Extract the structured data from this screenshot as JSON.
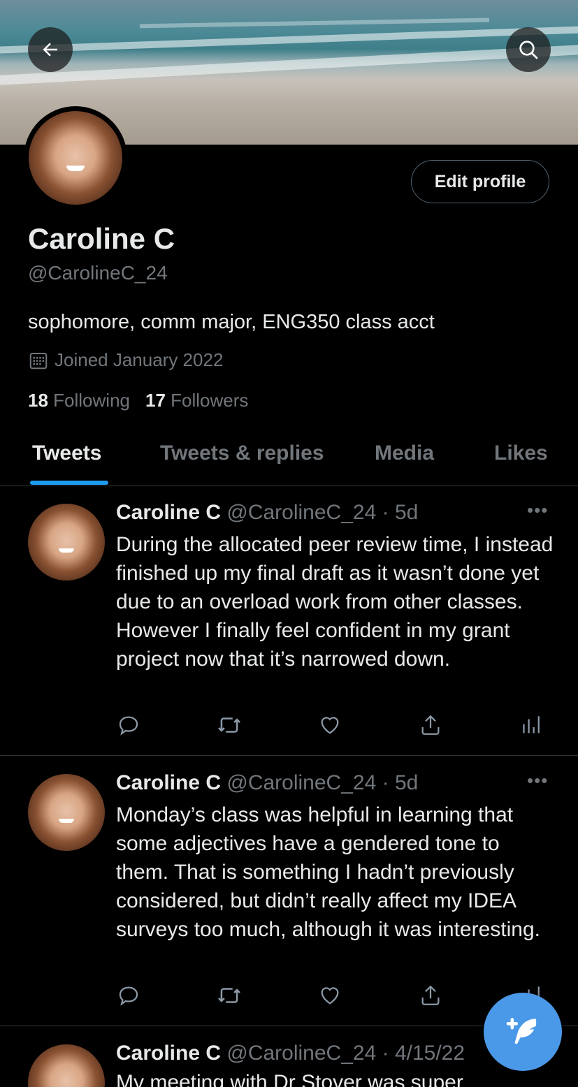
{
  "profile": {
    "name": "Caroline C",
    "handle": "@CarolineC_24",
    "bio": "sophomore, comm major, ENG350 class acct",
    "joined": "Joined January 2022",
    "following_count": "18",
    "following_label": "Following",
    "followers_count": "17",
    "followers_label": "Followers",
    "edit_label": "Edit profile"
  },
  "icons": {
    "back": "arrow-left-icon",
    "search": "search-icon",
    "calendar": "calendar-icon",
    "reply": "reply-icon",
    "retweet": "retweet-icon",
    "like": "heart-icon",
    "share": "share-icon",
    "analytics": "analytics-icon",
    "compose": "feather-plus-icon"
  },
  "tabs": [
    {
      "label": "Tweets",
      "active": true
    },
    {
      "label": "Tweets & replies",
      "active": false
    },
    {
      "label": "Media",
      "active": false
    },
    {
      "label": "Likes",
      "active": false
    }
  ],
  "tweets": [
    {
      "name": "Caroline C",
      "handle": "@CarolineC_24",
      "time": "· 5d",
      "more": "•••",
      "text": "During the allocated peer review time, I instead finished up my final draft as it wasn’t done yet due to an overload work from other classes. However I finally feel confident in my grant project now that it’s narrowed down."
    },
    {
      "name": "Caroline C",
      "handle": "@CarolineC_24",
      "time": "· 5d",
      "more": "•••",
      "text": "Monday’s class was helpful in learning that some adjectives have a gendered tone to them. That is something I hadn’t previously considered, but didn’t really affect my IDEA surveys too much, although it was interesting."
    },
    {
      "name": "Caroline C",
      "handle": "@CarolineC_24",
      "time": "· 4/15/22",
      "more": "",
      "text": "My meeting with Dr Stover was super"
    }
  ],
  "colors": {
    "background": "#000000",
    "accent": "#1d9bf0",
    "fab": "#4a99e9",
    "text": "#e7e9ea",
    "muted": "#71767b"
  }
}
